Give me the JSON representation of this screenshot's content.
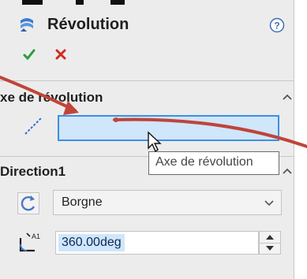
{
  "header": {
    "title": "Révolution",
    "feature_icon": "revolve-feature-icon",
    "help_icon": "help-icon"
  },
  "actions": {
    "ok_icon": "check-icon",
    "cancel_icon": "close-icon"
  },
  "axis_group": {
    "title": "xe de révolution",
    "field_value": "",
    "tooltip": "Axe de révolution"
  },
  "direction_group": {
    "title": "Direction1",
    "end_condition": "Borgne",
    "angle": "360.00deg"
  },
  "colors": {
    "accent": "#3f8fe0",
    "field_bg": "#cfe6fb",
    "panel_bg": "#ececec",
    "arrow": "#c0443a",
    "ok": "#2a9d3a",
    "cancel": "#d22a1e"
  }
}
